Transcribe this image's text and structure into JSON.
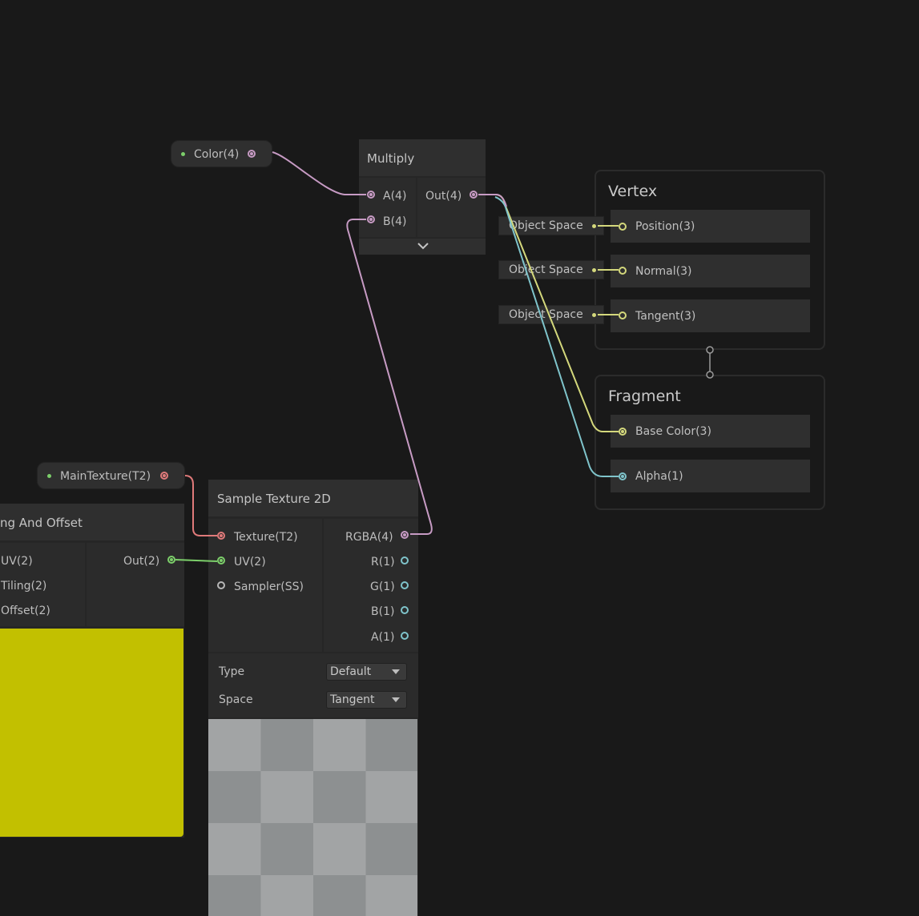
{
  "colors": {
    "canvas": "#191919",
    "vector4": "#c79bc4",
    "vector3": "#d4d87c",
    "vector2": "#7ccf6a",
    "vector1": "#7fc4cb",
    "texture": "#e07a7a",
    "sampler": "#b8b8b8",
    "preview_color": "#c2c000"
  },
  "properties": {
    "color": {
      "label": "Color(4)"
    },
    "main_texture": {
      "label": "MainTexture(T2)"
    }
  },
  "multiply": {
    "title": "Multiply",
    "inputs": [
      "A(4)",
      "B(4)"
    ],
    "output": "Out(4)",
    "expand_icon": "chevron-down-icon"
  },
  "tiling": {
    "title": "ng And Offset",
    "inputs": [
      "UV(2)",
      "Tiling(2)",
      "Offset(2)"
    ],
    "output": "Out(2)"
  },
  "sample_texture": {
    "title": "Sample Texture 2D",
    "inputs": [
      "Texture(T2)",
      "UV(2)",
      "Sampler(SS)"
    ],
    "outputs": [
      "RGBA(4)",
      "R(1)",
      "G(1)",
      "B(1)",
      "A(1)"
    ],
    "type_label": "Type",
    "type_value": "Default",
    "space_label": "Space",
    "space_value": "Tangent"
  },
  "vertex": {
    "title": "Vertex",
    "blocks": [
      "Position(3)",
      "Normal(3)",
      "Tangent(3)"
    ],
    "space": "Object Space"
  },
  "fragment": {
    "title": "Fragment",
    "blocks": [
      "Base Color(3)",
      "Alpha(1)"
    ]
  }
}
